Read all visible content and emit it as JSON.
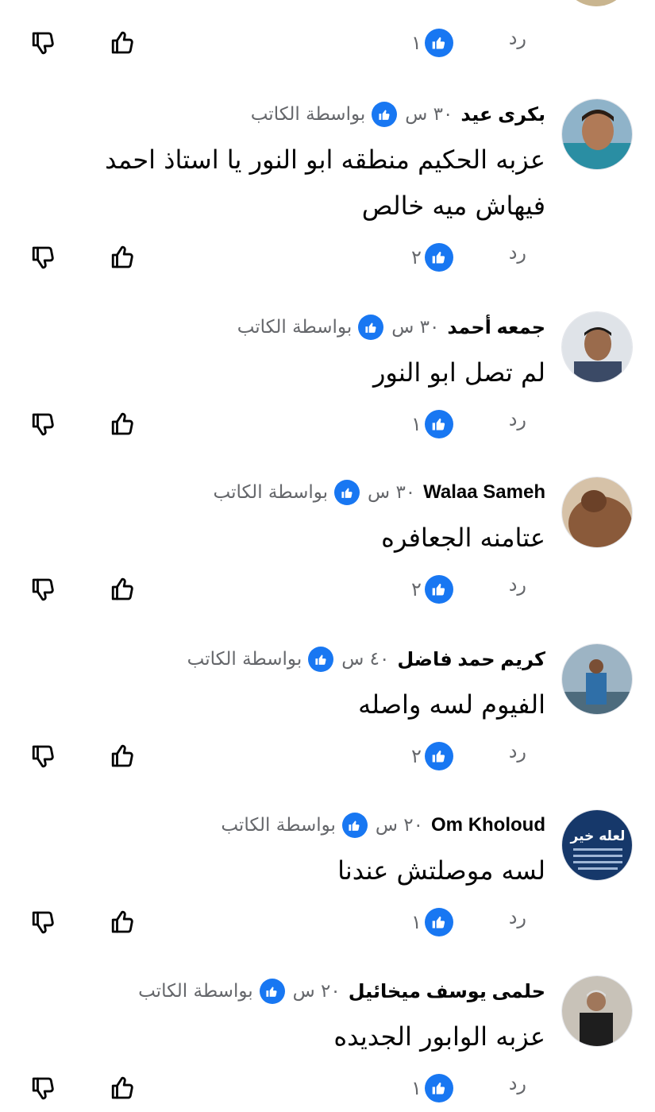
{
  "reply_label": "رد",
  "author_badge_label": "بواسطة الكاتب",
  "top_action_row": {
    "count": "١"
  },
  "comments": [
    {
      "author": "بكرى عيد",
      "time": "٣٠ س",
      "text": "عزبه الحكيم منطقه ابو النور يا استاذ احمد فيهاش ميه خالص",
      "count": "٢"
    },
    {
      "author": "جمعه أحمد",
      "time": "٣٠ س",
      "text": "لم تصل ابو النور",
      "count": "١"
    },
    {
      "author": "Walaa Sameh",
      "time": "٣٠ س",
      "text": "عتامنه الجعافره",
      "count": "٢"
    },
    {
      "author": "كريم حمد فاضل",
      "time": "٤٠ س",
      "text": "الفيوم لسه واصله",
      "count": "٢"
    },
    {
      "author": "Om Kholoud",
      "time": "٢٠ س",
      "text": "لسه موصلتش عندنا",
      "count": "١"
    },
    {
      "author": "حلمى يوسف ميخائيل",
      "time": "٢٠ س",
      "text": "عزبه الوابور الجديده",
      "count": "١"
    }
  ],
  "avatar_6_text": "لعله خير",
  "colors": {
    "accent": "#1877f2",
    "secondary_text": "#65676b",
    "primary_text": "#050505"
  }
}
